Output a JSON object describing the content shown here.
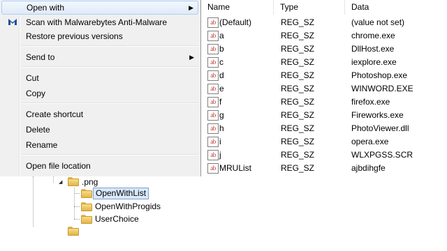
{
  "context_menu": {
    "items": [
      {
        "label": "Open with",
        "submenu": true,
        "highlighted": true
      },
      {
        "label": "Scan with Malwarebytes Anti-Malware",
        "icon": "malwarebytes-icon"
      },
      {
        "label": "Restore previous versions"
      },
      {
        "label": "Send to",
        "submenu": true
      },
      {
        "label": "Cut"
      },
      {
        "label": "Copy"
      },
      {
        "label": "Create shortcut"
      },
      {
        "label": "Delete"
      },
      {
        "label": "Rename"
      },
      {
        "label": "Open file location"
      }
    ],
    "submenu_arrow": "▶"
  },
  "registry": {
    "columns": {
      "name": "Name",
      "type": "Type",
      "data": "Data"
    },
    "rows": [
      {
        "name": "(Default)",
        "type": "REG_SZ",
        "data": "(value not set)"
      },
      {
        "name": "a",
        "type": "REG_SZ",
        "data": "chrome.exe"
      },
      {
        "name": "b",
        "type": "REG_SZ",
        "data": "DllHost.exe"
      },
      {
        "name": "c",
        "type": "REG_SZ",
        "data": "iexplore.exe"
      },
      {
        "name": "d",
        "type": "REG_SZ",
        "data": "Photoshop.exe"
      },
      {
        "name": "e",
        "type": "REG_SZ",
        "data": "WINWORD.EXE"
      },
      {
        "name": "f",
        "type": "REG_SZ",
        "data": "firefox.exe"
      },
      {
        "name": "g",
        "type": "REG_SZ",
        "data": "Fireworks.exe"
      },
      {
        "name": "h",
        "type": "REG_SZ",
        "data": "PhotoViewer.dll"
      },
      {
        "name": "i",
        "type": "REG_SZ",
        "data": "opera.exe"
      },
      {
        "name": "j",
        "type": "REG_SZ",
        "data": "WLXPGSS.SCR"
      },
      {
        "name": "MRUList",
        "type": "REG_SZ",
        "data": "ajbdihgfe"
      }
    ],
    "value_icon": "ab"
  },
  "tree": {
    "parent": {
      "label": ".png",
      "expanded": true
    },
    "children": [
      {
        "label": "OpenWithList",
        "selected": true
      },
      {
        "label": "OpenWithProgids"
      },
      {
        "label": "UserChoice"
      }
    ]
  },
  "colors": {
    "menu_bg": "#f0f0f0",
    "menu_highlight": "#dfeaf8",
    "tree_selection": "#d9e8fb",
    "value_icon_red": "#c0392b"
  }
}
